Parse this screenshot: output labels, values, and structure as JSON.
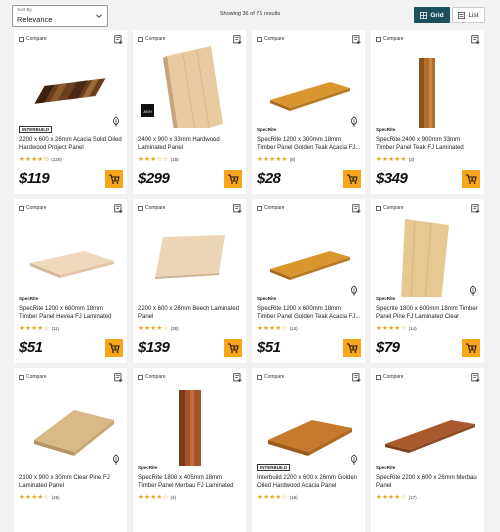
{
  "sort": {
    "label": "Sort By",
    "value": "Relevance"
  },
  "results_text": "Showing 36 of 71 results",
  "view": {
    "grid_label": "Grid",
    "list_label": "List"
  },
  "compare_label": "Compare",
  "products": [
    {
      "title": "2200 x 600 x 26mm Acacia Solid Oiled Hardwood Project Panel",
      "brand": "INTERBUILD",
      "rating": "★★★★½",
      "reviews": "(125)",
      "price": "$119",
      "eco": true,
      "img": "acacia"
    },
    {
      "title": "2400 x 900 x 33mm Hardwood Laminated Panel",
      "brand": "",
      "rating": "★★★☆☆",
      "reviews": "(18)",
      "price": "$299",
      "eco": false,
      "img": "pale-tall",
      "badge": "ASH"
    },
    {
      "title": "SpecRite 1200 x 300mm 18mm Timber Panel Golden Teak Acacia FJ...",
      "brand": "SpecRite",
      "rating": "★★★★★",
      "reviews": "(8)",
      "price": "$28",
      "eco": true,
      "img": "teak-flat"
    },
    {
      "title": "SpecRite 2400 x 900mm 33mm Timber Panel Teak FJ Laminated",
      "brand": "SpecRite",
      "rating": "★★★★★",
      "reviews": "(3)",
      "price": "$349",
      "eco": false,
      "img": "teak-tall"
    },
    {
      "title": "SpecRite 1200 x 600mm 18mm Timber Panel Hevea FJ Laminated",
      "brand": "SpecRite",
      "rating": "★★★★☆",
      "reviews": "(11)",
      "price": "$51",
      "eco": false,
      "img": "hevea"
    },
    {
      "title": "2200 x 600 x 26mm Beech Laminated Panel",
      "brand": "",
      "rating": "★★★★☆",
      "reviews": "(38)",
      "price": "$139",
      "eco": false,
      "img": "beech"
    },
    {
      "title": "SpecRite 1200 x 600mm 18mm Timber Panel Golden Teak Acacia FJ...",
      "brand": "SpecRite",
      "rating": "★★★★☆",
      "reviews": "(14)",
      "price": "$51",
      "eco": true,
      "img": "teak-flat"
    },
    {
      "title": "Specrite 1800 x 600mm 18mm Timber Panel Pine FJ Laminated Clear",
      "brand": "SpecRite",
      "rating": "★★★★☆",
      "reviews": "(14)",
      "price": "$79",
      "eco": true,
      "img": "pine-tall"
    },
    {
      "title": "2100 x 900 x 30mm Clear Pine FJ Laminated Panel",
      "brand": "",
      "rating": "★★★★☆",
      "reviews": "(26)",
      "price": "",
      "eco": true,
      "img": "pine-flat"
    },
    {
      "title": "SpecRite 1800 x 405mm 18mm Timber Panel Merbau FJ Laminated",
      "brand": "SpecRite",
      "rating": "★★★★☆",
      "reviews": "(4)",
      "price": "",
      "eco": false,
      "img": "merbau-tall"
    },
    {
      "title": "Interbuild 2200 x 600 x 26mm Golden Oiled Hardwood Acacia Panel",
      "brand": "INTERBUILD",
      "rating": "★★★★☆",
      "reviews": "(19)",
      "price": "",
      "eco": true,
      "img": "golden-flat"
    },
    {
      "title": "SpecRite 2200 x 600 x 26mm Merbau Panel",
      "brand": "SpecRite",
      "rating": "★★★★☆",
      "reviews": "(17)",
      "price": "",
      "eco": false,
      "img": "merbau-flat"
    }
  ]
}
